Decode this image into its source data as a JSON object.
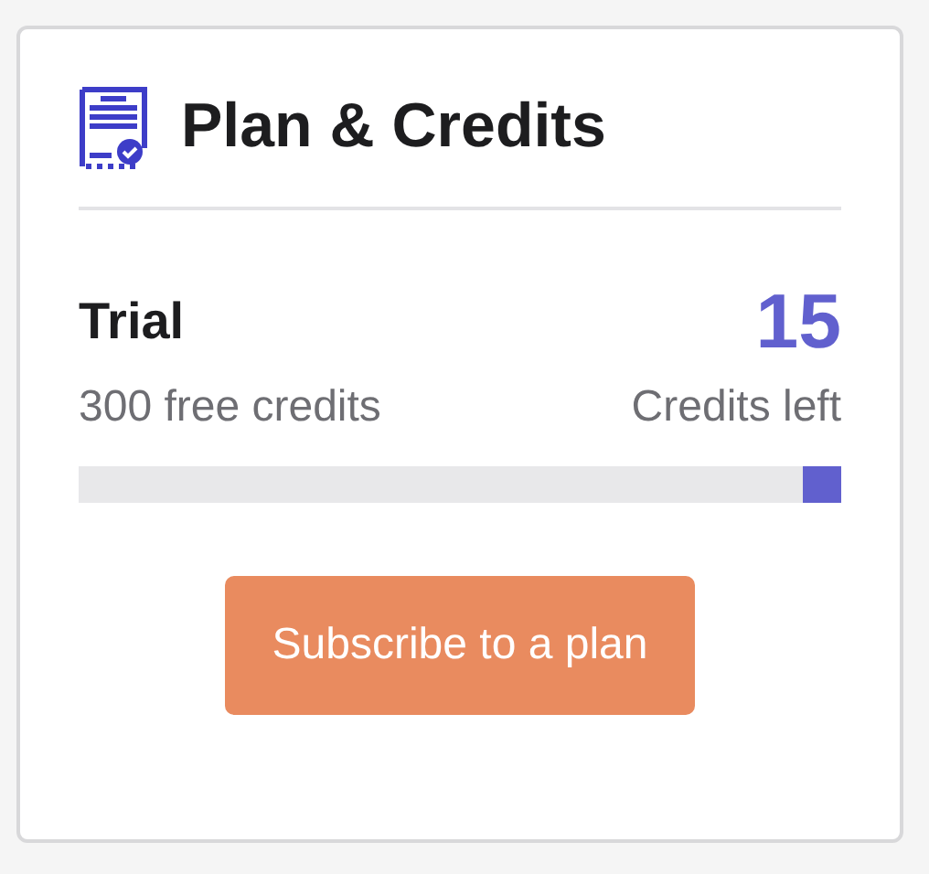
{
  "card": {
    "title": "Plan & Credits"
  },
  "plan": {
    "name": "Trial",
    "description": "300 free credits",
    "credits": "15",
    "credits_label": "Credits left",
    "level": 0.05
  },
  "button": {
    "label": "Subscribe to a plan"
  }
}
